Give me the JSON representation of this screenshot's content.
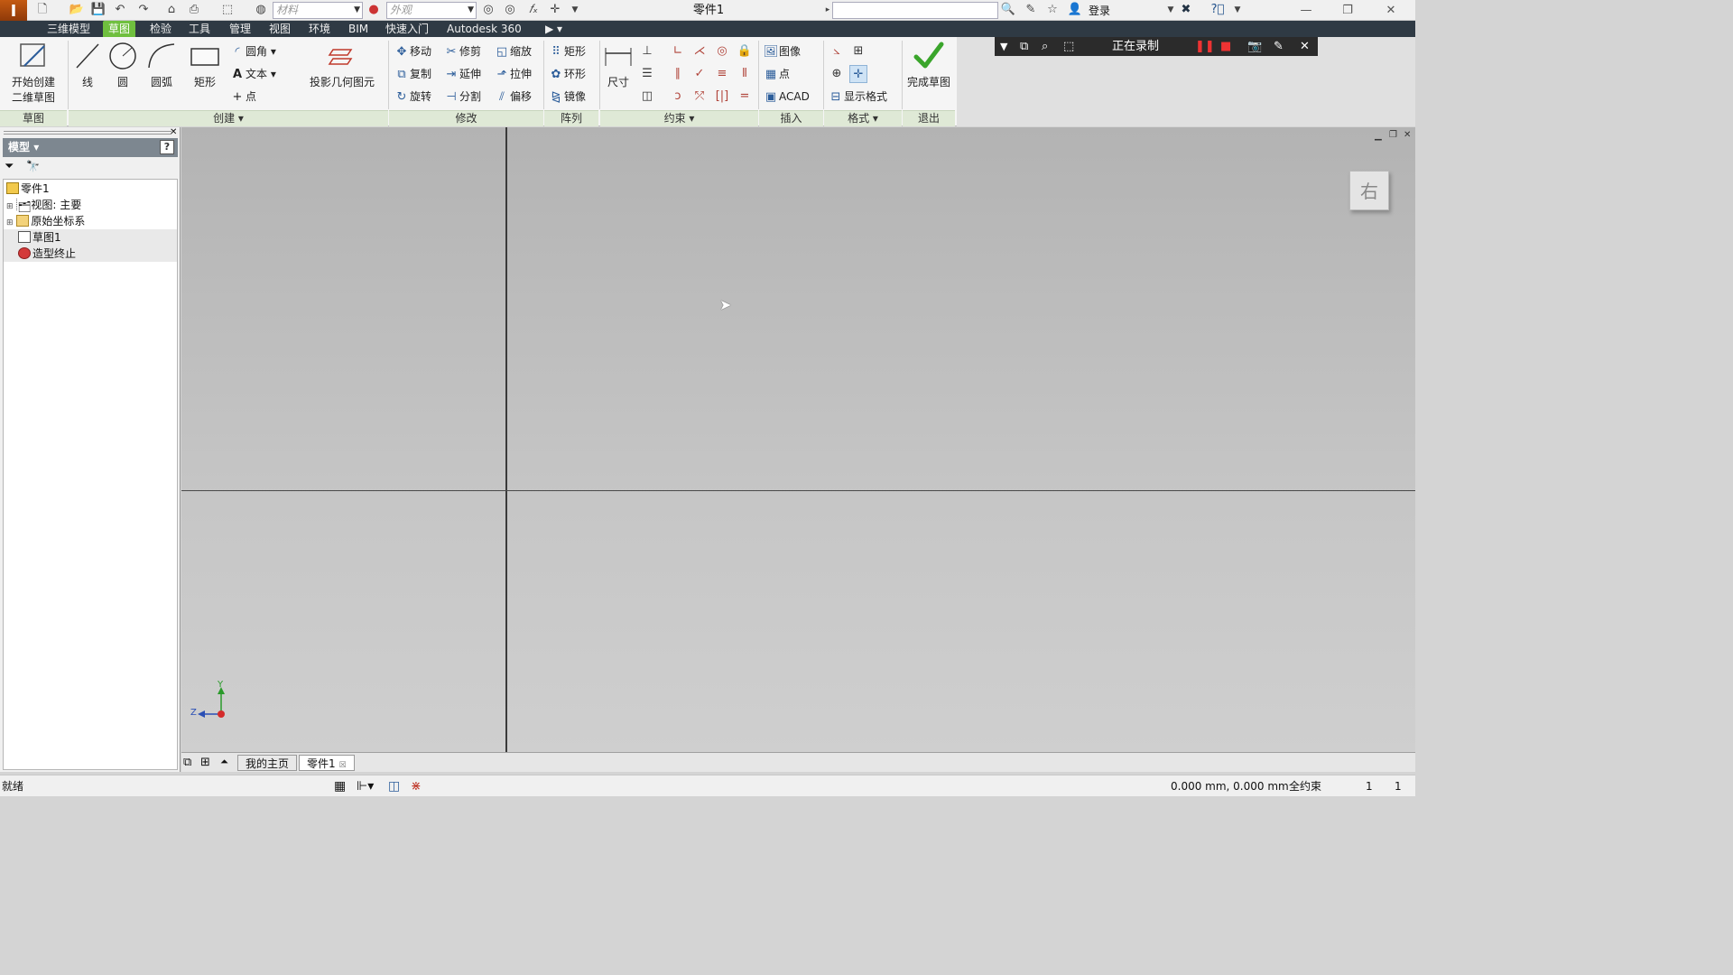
{
  "titlebar": {
    "material_placeholder": "材料",
    "appearance_placeholder": "外观",
    "document_title": "零件1",
    "login_label": "登录"
  },
  "menu": {
    "tabs": [
      "三维模型",
      "草图",
      "检验",
      "工具",
      "管理",
      "视图",
      "环境",
      "BIM",
      "快速入门",
      "Autodesk 360"
    ],
    "active": "草图"
  },
  "ribbon": {
    "sketch_panel": {
      "start_label_line1": "开始创建",
      "start_label_line2": "二维草图",
      "title": "草图"
    },
    "create_panel": {
      "line": "线",
      "circle": "圆",
      "arc": "圆弧",
      "rectangle": "矩形",
      "fillet": "圆角",
      "text": "文本",
      "point": "点",
      "project": "投影几何图元",
      "title": "创建"
    },
    "modify_panel": {
      "move": "移动",
      "trim": "修剪",
      "scale": "缩放",
      "copy": "复制",
      "extend": "延伸",
      "stretch": "拉伸",
      "rotate": "旋转",
      "split": "分割",
      "offset": "偏移",
      "title": "修改"
    },
    "pattern_panel": {
      "rect": "矩形",
      "circular": "环形",
      "mirror": "镜像",
      "title": "阵列"
    },
    "constrain_panel": {
      "dimension": "尺寸",
      "title": "约束"
    },
    "insert_panel": {
      "image": "图像",
      "point": "点",
      "acad": "ACAD",
      "title": "插入"
    },
    "format_panel": {
      "show_format": "显示格式",
      "title": "格式"
    },
    "exit_panel": {
      "finish": "完成草图",
      "title": "退出"
    }
  },
  "recording": {
    "status": "正在录制"
  },
  "browser": {
    "header": "模型",
    "tree": [
      {
        "label": "零件1",
        "indent": 0
      },
      {
        "label": "视图: 主要",
        "indent": 1
      },
      {
        "label": "原始坐标系",
        "indent": 1
      },
      {
        "label": "草图1",
        "indent": 1
      },
      {
        "label": "造型终止",
        "indent": 1
      }
    ]
  },
  "viewcube": {
    "face_label": "右"
  },
  "triad": {
    "y": "Y",
    "z": "Z"
  },
  "doc_tabs": {
    "home": "我的主页",
    "part": "零件1"
  },
  "status": {
    "ready": "就绪",
    "coords": "0.000 mm, 0.000 mm",
    "constraint": "全约束",
    "count_a": "1",
    "count_b": "1"
  },
  "colors": {
    "accent_tab": "#6fbf3e",
    "menubar": "#2f3a44",
    "finish_check": "#3aa52b"
  }
}
